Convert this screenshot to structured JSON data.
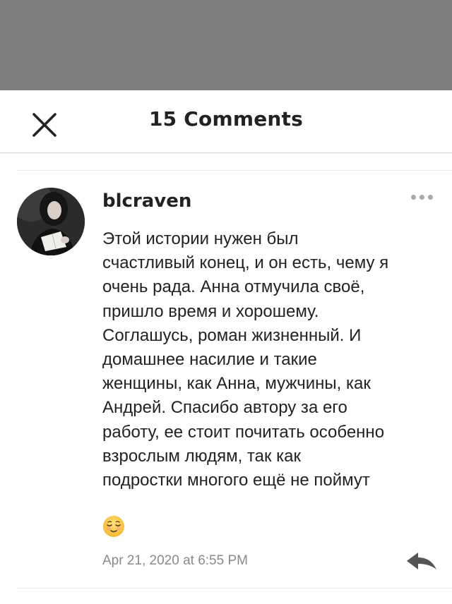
{
  "header": {
    "title": "15 Comments"
  },
  "comment": {
    "username": "blcraven",
    "body_lines": [
      "Этой истории нужен был",
      "счастливый конец, и он есть, чему я",
      "очень рада. Анна отмучила своё,",
      "пришло время и хорошему.",
      "Соглашусь, роман жизненный. И",
      "домашнее насилие и такие",
      "женщины, как Анна, мужчины, как",
      "Андрей. Спасибо автору за его",
      "работу, ее стоит почитать особенно",
      "взрослым людям, так как",
      "подростки многого ещё не поймут"
    ],
    "emoji": "relieved-face-emoji",
    "timestamp": "Apr 21, 2020 at 6:55 PM"
  },
  "icons": {
    "close": "close-icon",
    "more": "more-horizontal-icon",
    "reply": "reply-arrow-icon"
  },
  "colors": {
    "overlay": "#7f7f80",
    "text": "#222222",
    "muted": "#8a8a8a",
    "icon_gray": "#555555"
  }
}
